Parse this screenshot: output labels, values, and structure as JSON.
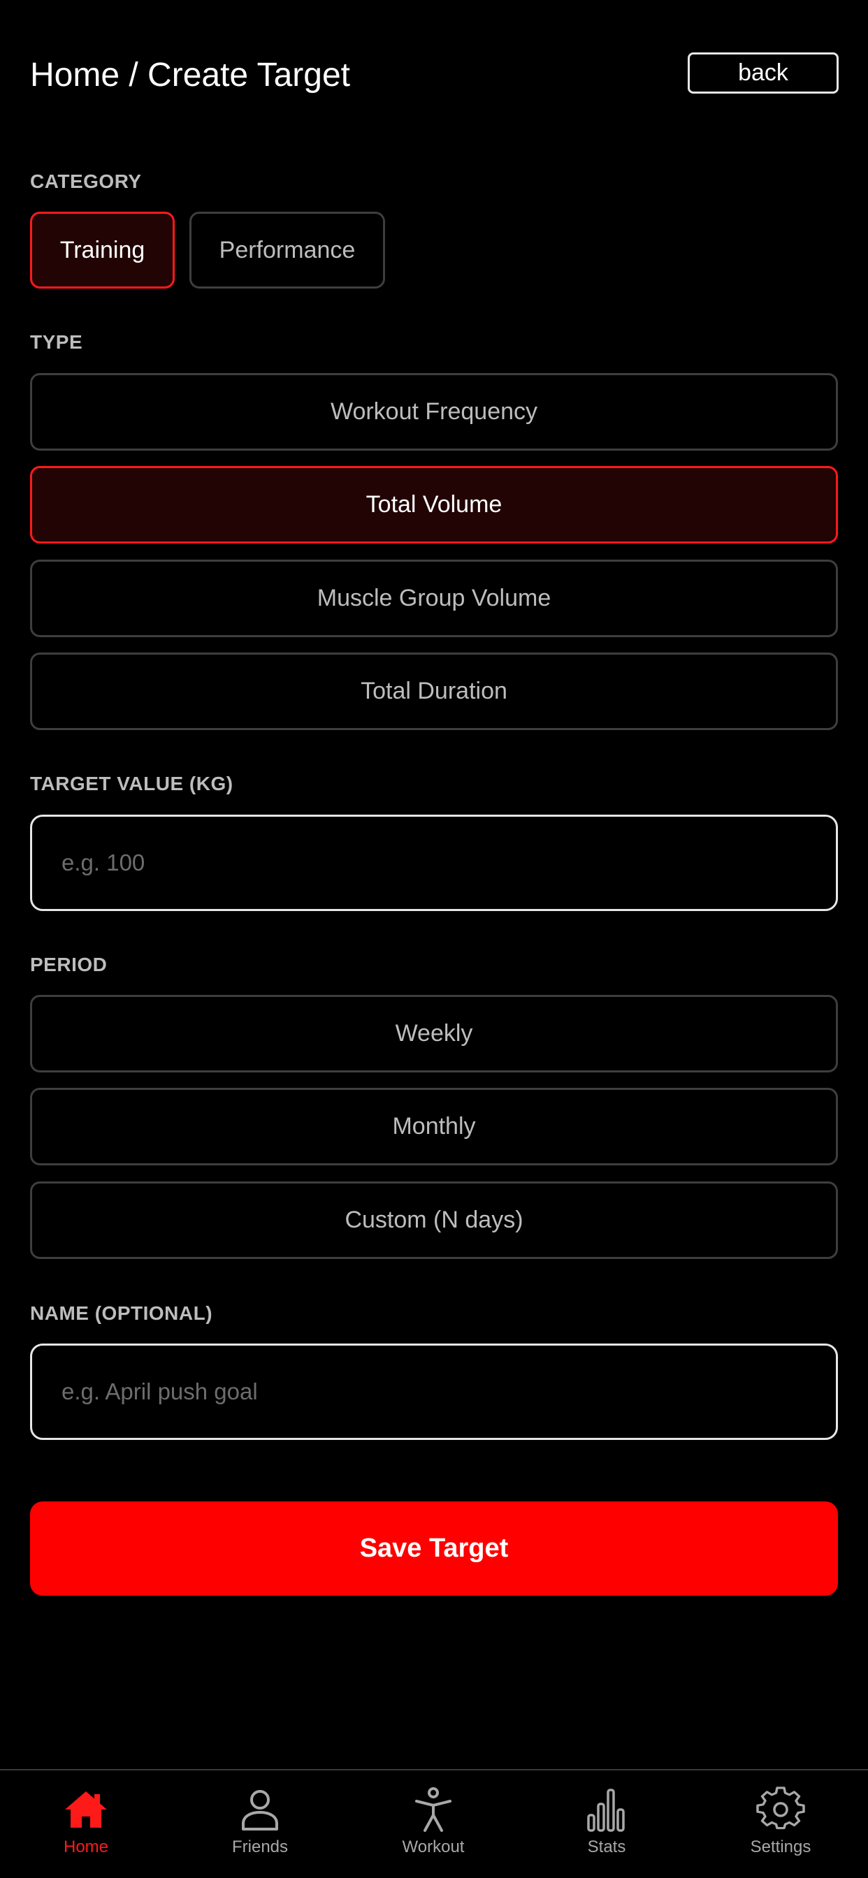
{
  "header": {
    "title": "Home / Create Target",
    "back_label": "back"
  },
  "category": {
    "label": "CATEGORY",
    "options": [
      "Training",
      "Performance"
    ],
    "selected": "Training"
  },
  "type": {
    "label": "TYPE",
    "options": [
      "Workout Frequency",
      "Total Volume",
      "Muscle Group Volume",
      "Total Duration"
    ],
    "selected": "Total Volume"
  },
  "target_value": {
    "label": "TARGET VALUE (KG)",
    "placeholder": "e.g. 100",
    "value": ""
  },
  "period": {
    "label": "PERIOD",
    "options": [
      "Weekly",
      "Monthly",
      "Custom (N days)"
    ],
    "selected": null
  },
  "name": {
    "label": "NAME (OPTIONAL)",
    "placeholder": "e.g. April push goal",
    "value": ""
  },
  "save_label": "Save Target",
  "tabbar": {
    "items": [
      {
        "label": "Home",
        "icon": "home-icon"
      },
      {
        "label": "Friends",
        "icon": "user-icon"
      },
      {
        "label": "Workout",
        "icon": "person-figure-icon"
      },
      {
        "label": "Stats",
        "icon": "bar-chart-icon"
      },
      {
        "label": "Settings",
        "icon": "gear-icon"
      }
    ],
    "active": "Home"
  },
  "colors": {
    "background": "#000000",
    "accent": "#ff0000",
    "selected_bg": "#220405",
    "border": "#3e3e3e",
    "text_muted": "#bdbdbd"
  }
}
